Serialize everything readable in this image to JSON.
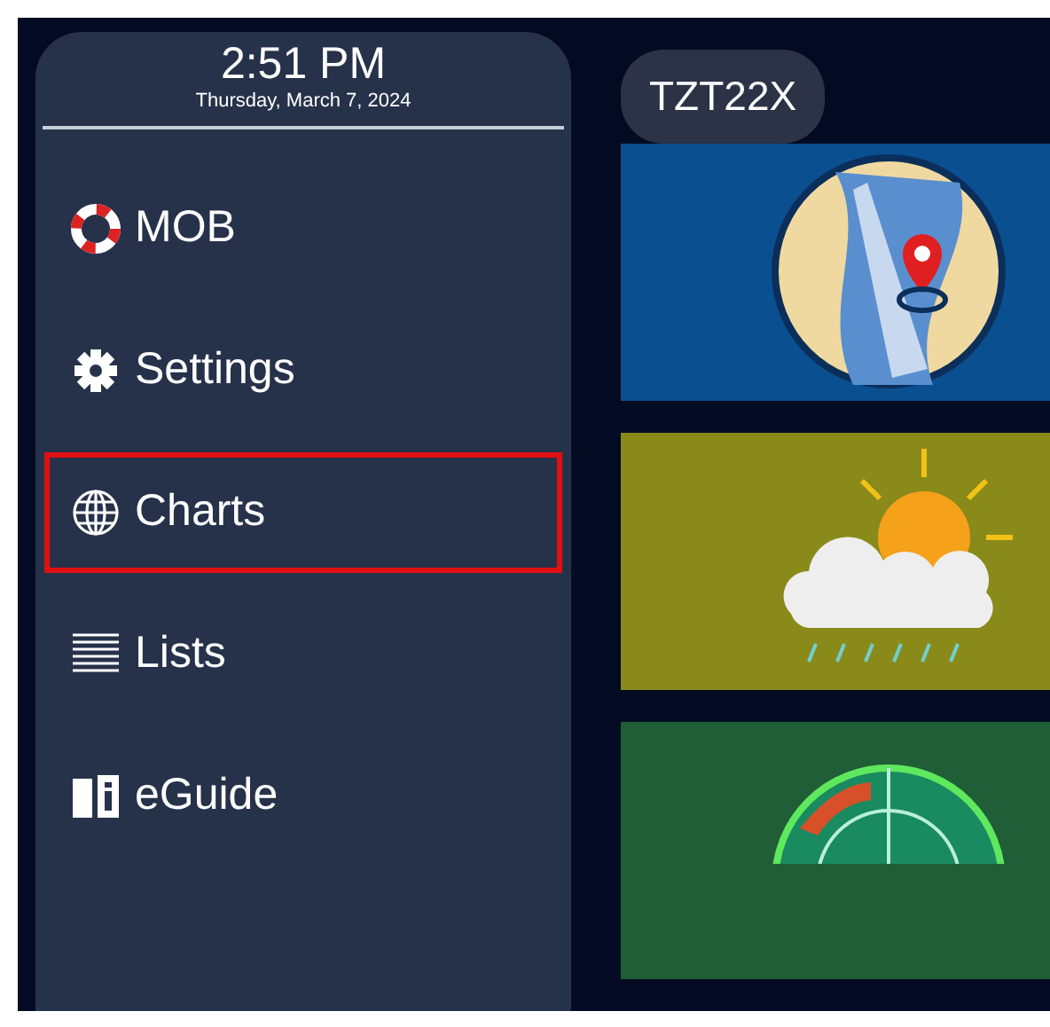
{
  "clock": {
    "time": "2:51 PM",
    "date": "Thursday, March 7, 2024"
  },
  "menu": [
    {
      "kind": "mob",
      "label": "MOB",
      "selected": false
    },
    {
      "kind": "settings",
      "label": "Settings",
      "selected": false
    },
    {
      "kind": "charts",
      "label": "Charts",
      "selected": true
    },
    {
      "kind": "lists",
      "label": "Lists",
      "selected": false
    },
    {
      "kind": "eguide",
      "label": "eGuide",
      "selected": false
    }
  ],
  "device": {
    "name": "TZT22X"
  },
  "tiles": [
    {
      "kind": "chart"
    },
    {
      "kind": "weather"
    },
    {
      "kind": "radar"
    }
  ]
}
